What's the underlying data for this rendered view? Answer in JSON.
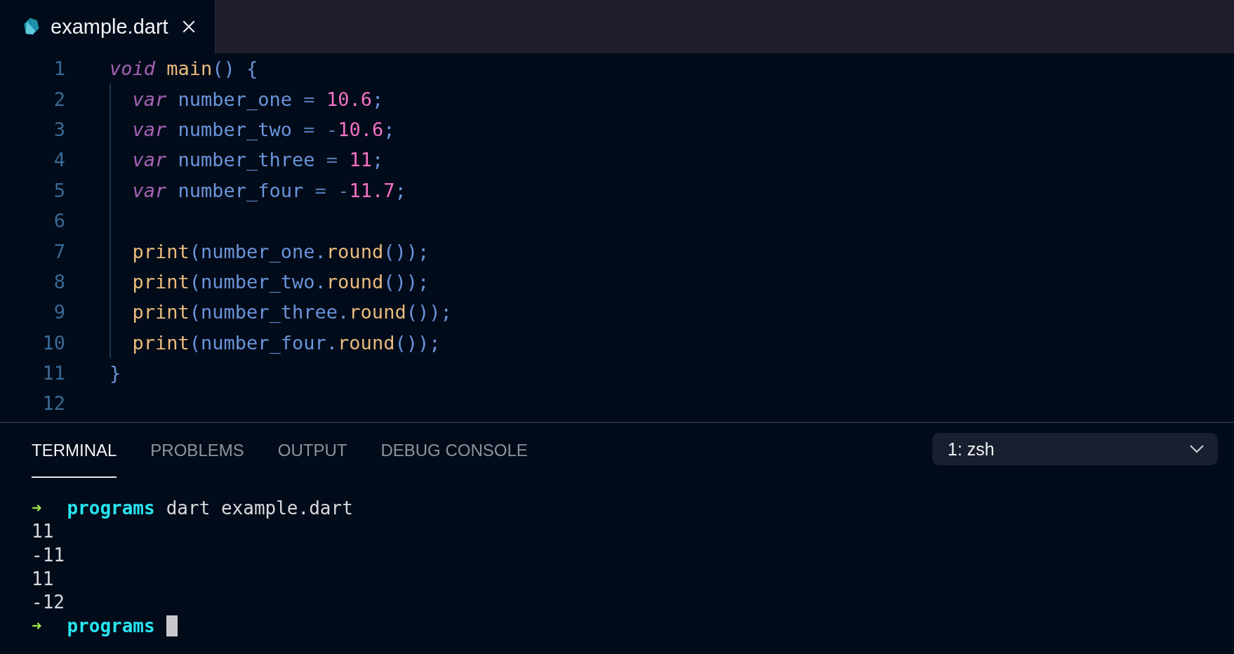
{
  "editor_tabs": [
    {
      "label": "example.dart",
      "selected": true
    }
  ],
  "code_lines": [
    {
      "number": "1",
      "indent": false,
      "tokens": [
        {
          "kind": "keyword",
          "text": "void"
        },
        {
          "kind": "function",
          "text": " main"
        },
        {
          "kind": "punct",
          "text": "() {"
        }
      ]
    },
    {
      "number": "2",
      "indent": true,
      "tokens": [
        {
          "kind": "keyword",
          "text": "var"
        },
        {
          "kind": "ident",
          "text": " number_one"
        },
        {
          "kind": "operator",
          "text": " = "
        },
        {
          "kind": "number",
          "text": "10.6"
        },
        {
          "kind": "punct",
          "text": ";"
        }
      ]
    },
    {
      "number": "3",
      "indent": true,
      "tokens": [
        {
          "kind": "keyword",
          "text": "var"
        },
        {
          "kind": "ident",
          "text": " number_two"
        },
        {
          "kind": "operator",
          "text": " = -"
        },
        {
          "kind": "number",
          "text": "10.6"
        },
        {
          "kind": "punct",
          "text": ";"
        }
      ]
    },
    {
      "number": "4",
      "indent": true,
      "tokens": [
        {
          "kind": "keyword",
          "text": "var"
        },
        {
          "kind": "ident",
          "text": " number_three"
        },
        {
          "kind": "operator",
          "text": " = "
        },
        {
          "kind": "number",
          "text": "11"
        },
        {
          "kind": "punct",
          "text": ";"
        }
      ]
    },
    {
      "number": "5",
      "indent": true,
      "tokens": [
        {
          "kind": "keyword",
          "text": "var"
        },
        {
          "kind": "ident",
          "text": " number_four"
        },
        {
          "kind": "operator",
          "text": " = -"
        },
        {
          "kind": "number",
          "text": "11.7"
        },
        {
          "kind": "punct",
          "text": ";"
        }
      ]
    },
    {
      "number": "6",
      "indent": true
    },
    {
      "number": "7",
      "indent": true,
      "tokens": [
        {
          "kind": "function",
          "text": "print"
        },
        {
          "kind": "punct",
          "text": "(number_one."
        },
        {
          "kind": "function",
          "text": "round"
        },
        {
          "kind": "punct",
          "text": "());"
        }
      ]
    },
    {
      "number": "8",
      "indent": true,
      "tokens": [
        {
          "kind": "function",
          "text": "print"
        },
        {
          "kind": "punct",
          "text": "(number_two."
        },
        {
          "kind": "function",
          "text": "round"
        },
        {
          "kind": "punct",
          "text": "());"
        }
      ]
    },
    {
      "number": "9",
      "indent": true,
      "tokens": [
        {
          "kind": "function",
          "text": "print"
        },
        {
          "kind": "punct",
          "text": "(number_three."
        },
        {
          "kind": "function",
          "text": "round"
        },
        {
          "kind": "punct",
          "text": "());"
        }
      ]
    },
    {
      "number": "10",
      "indent": true,
      "tokens": [
        {
          "kind": "function",
          "text": "print"
        },
        {
          "kind": "punct",
          "text": "(number_four."
        },
        {
          "kind": "function",
          "text": "round"
        },
        {
          "kind": "punct",
          "text": "());"
        }
      ]
    },
    {
      "number": "11",
      "indent": false,
      "tokens": [
        {
          "kind": "punct",
          "text": "}"
        }
      ]
    },
    {
      "number": "12",
      "indent": false
    }
  ],
  "panel_tabs": [
    {
      "label": "TERMINAL",
      "selected": true
    },
    {
      "label": "PROBLEMS",
      "selected": false
    },
    {
      "label": "OUTPUT",
      "selected": false
    },
    {
      "label": "DEBUG CONSOLE",
      "selected": false
    }
  ],
  "terminal_select": {
    "value": "1: zsh"
  },
  "terminal_lines": [
    {
      "kind": "prompt",
      "arrow": "➜",
      "dir": "programs",
      "command": "dart example.dart",
      "cursor": false
    },
    {
      "kind": "output",
      "text": "11"
    },
    {
      "kind": "output",
      "text": "-11"
    },
    {
      "kind": "output",
      "text": "11"
    },
    {
      "kind": "output",
      "text": "-12"
    },
    {
      "kind": "prompt",
      "arrow": "➜",
      "dir": "programs",
      "cursor": true
    }
  ]
}
